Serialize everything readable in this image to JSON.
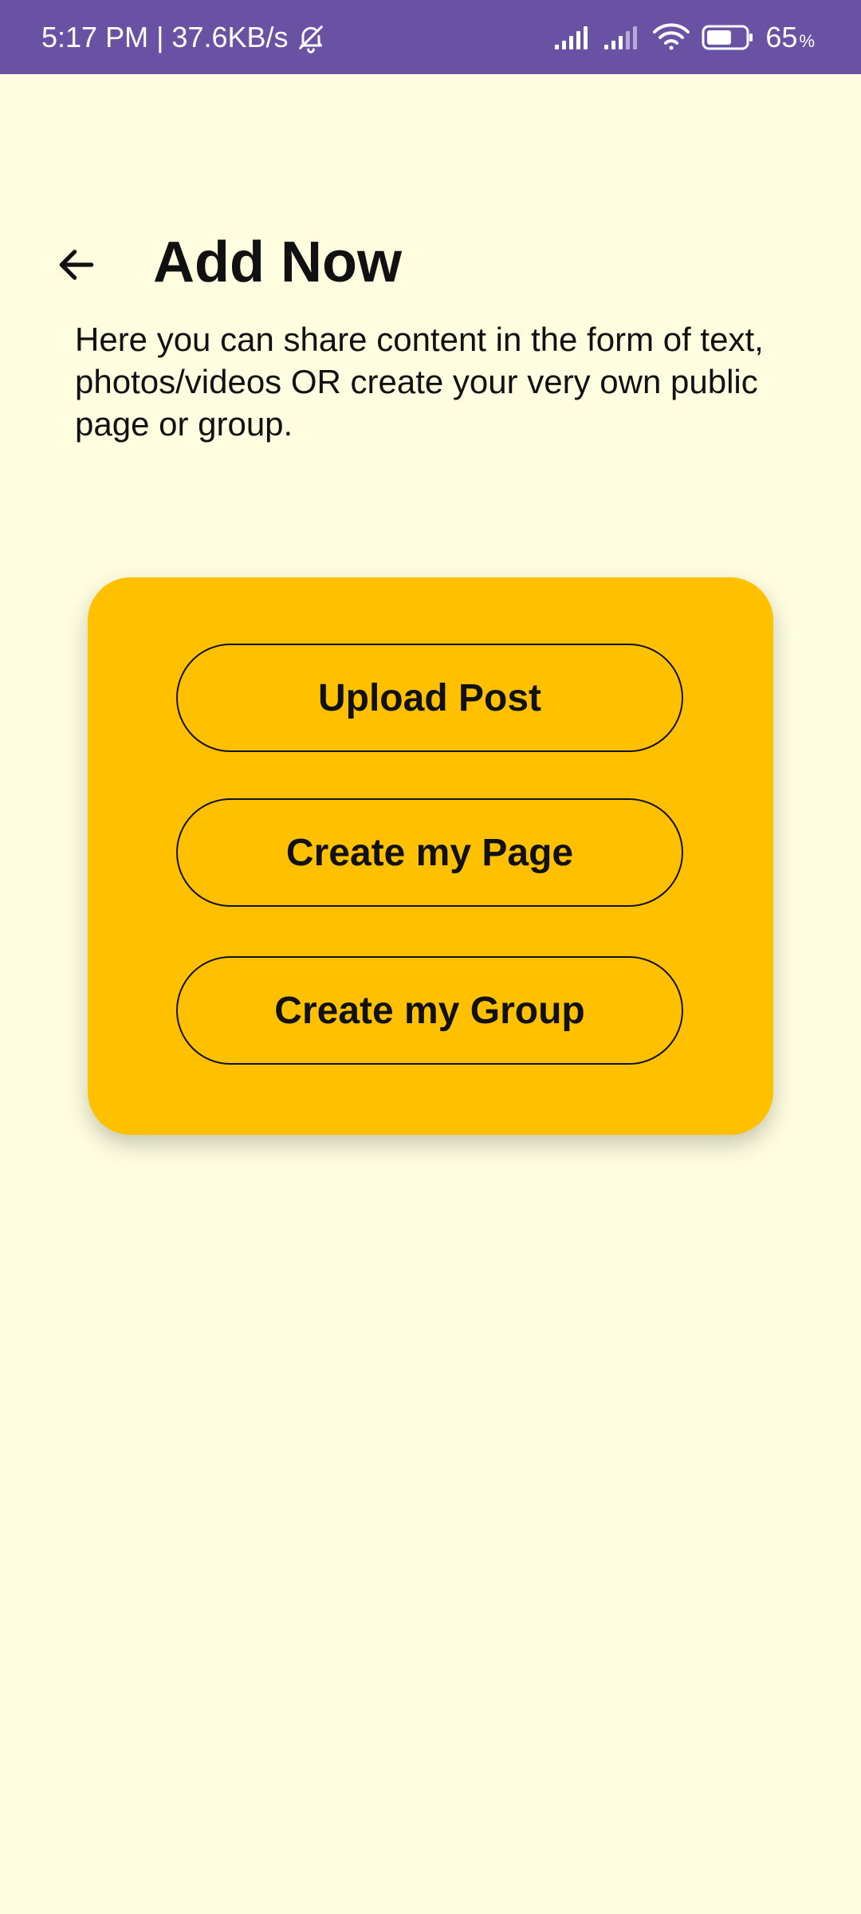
{
  "status_bar": {
    "time_speed": "5:17 PM | 37.6KB/s",
    "battery_percent": "65",
    "battery_percent_sign": "%",
    "battery_level": 0.65,
    "background_color": "#6951A4"
  },
  "header": {
    "back_icon": "arrow-left-icon",
    "title": "Add Now"
  },
  "description": "Here you can share content in the form of text, photos/videos OR create your very own public page or group.",
  "card": {
    "color": "#FFC000",
    "buttons": [
      {
        "label": "Upload Post"
      },
      {
        "label": "Create my Page"
      },
      {
        "label": "Create my Group"
      }
    ]
  },
  "colors": {
    "page_background": "#FEFDE0",
    "accent": "#FFC000",
    "status_bar": "#6951A4"
  }
}
